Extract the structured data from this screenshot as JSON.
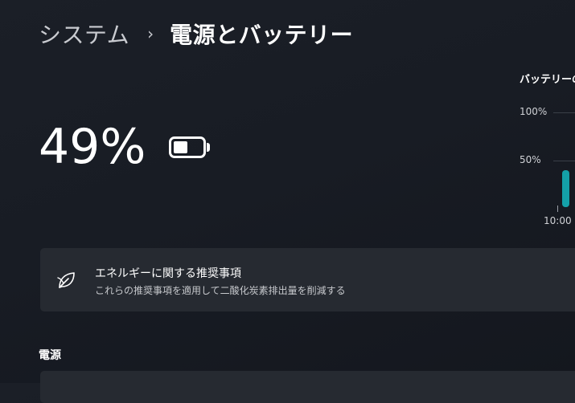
{
  "breadcrumb": {
    "parent": "システム",
    "separator": "›",
    "current": "電源とバッテリー"
  },
  "battery": {
    "percent_text": "49%",
    "level": 0.49,
    "icon": "battery-icon"
  },
  "usage_chart": {
    "title": "バッテリーの",
    "chart_data": {
      "type": "bar",
      "title": "バッテリーの",
      "y_tick_labels": [
        "100%",
        "50%"
      ],
      "x_tick_labels": [
        "10:00"
      ],
      "ylim": [
        0,
        100
      ],
      "series": [
        {
          "values": [
            40
          ]
        }
      ],
      "bar_color": "#14a0a8",
      "grid": true
    }
  },
  "recommendations": {
    "icon": "leaf-icon",
    "title": "エネルギーに関する推奨事項",
    "subtitle": "これらの推奨事項を適用して二酸化炭素排出量を削減する"
  },
  "power_section": {
    "heading": "電源"
  },
  "colors": {
    "accent": "#14a0a8",
    "card_bg": "#262a31"
  }
}
